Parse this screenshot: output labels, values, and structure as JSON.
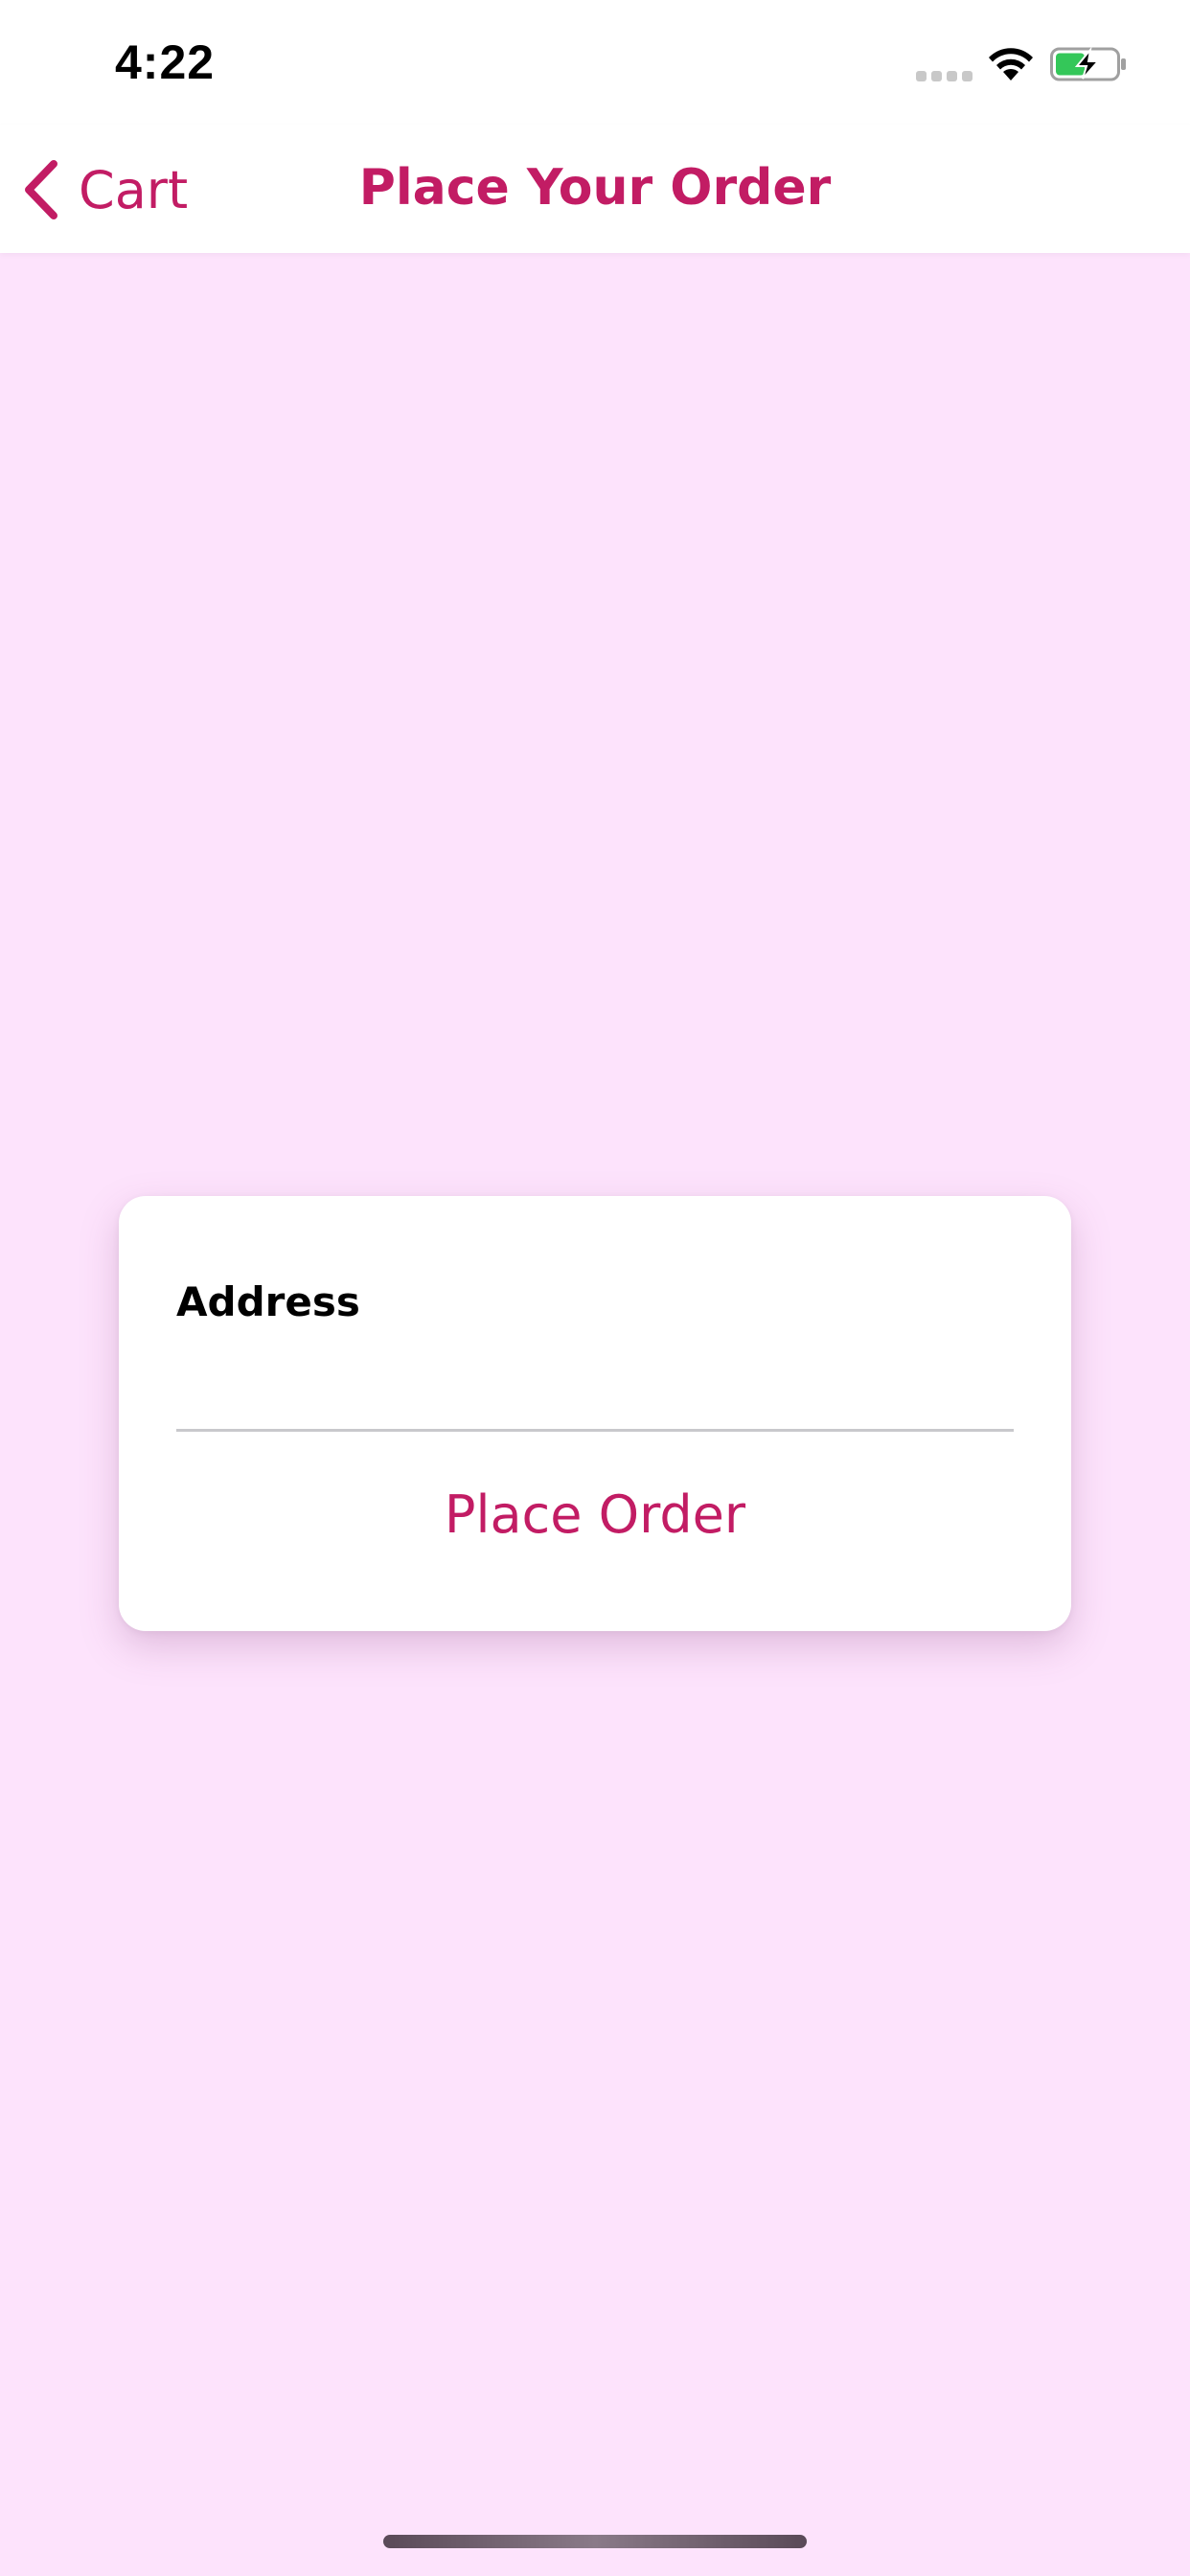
{
  "status_bar": {
    "time": "4:22",
    "icons": [
      "signal-icon",
      "wifi-icon",
      "battery-charging-icon"
    ],
    "battery_color": "#34c759"
  },
  "nav": {
    "back_label": "Cart",
    "title": "Place Your Order",
    "accent_color": "#c21c64"
  },
  "form": {
    "address_label": "Address",
    "address_value": "",
    "address_placeholder": "",
    "submit_label": "Place Order"
  },
  "colors": {
    "background": "#fde3fc",
    "accent": "#c21c64"
  }
}
